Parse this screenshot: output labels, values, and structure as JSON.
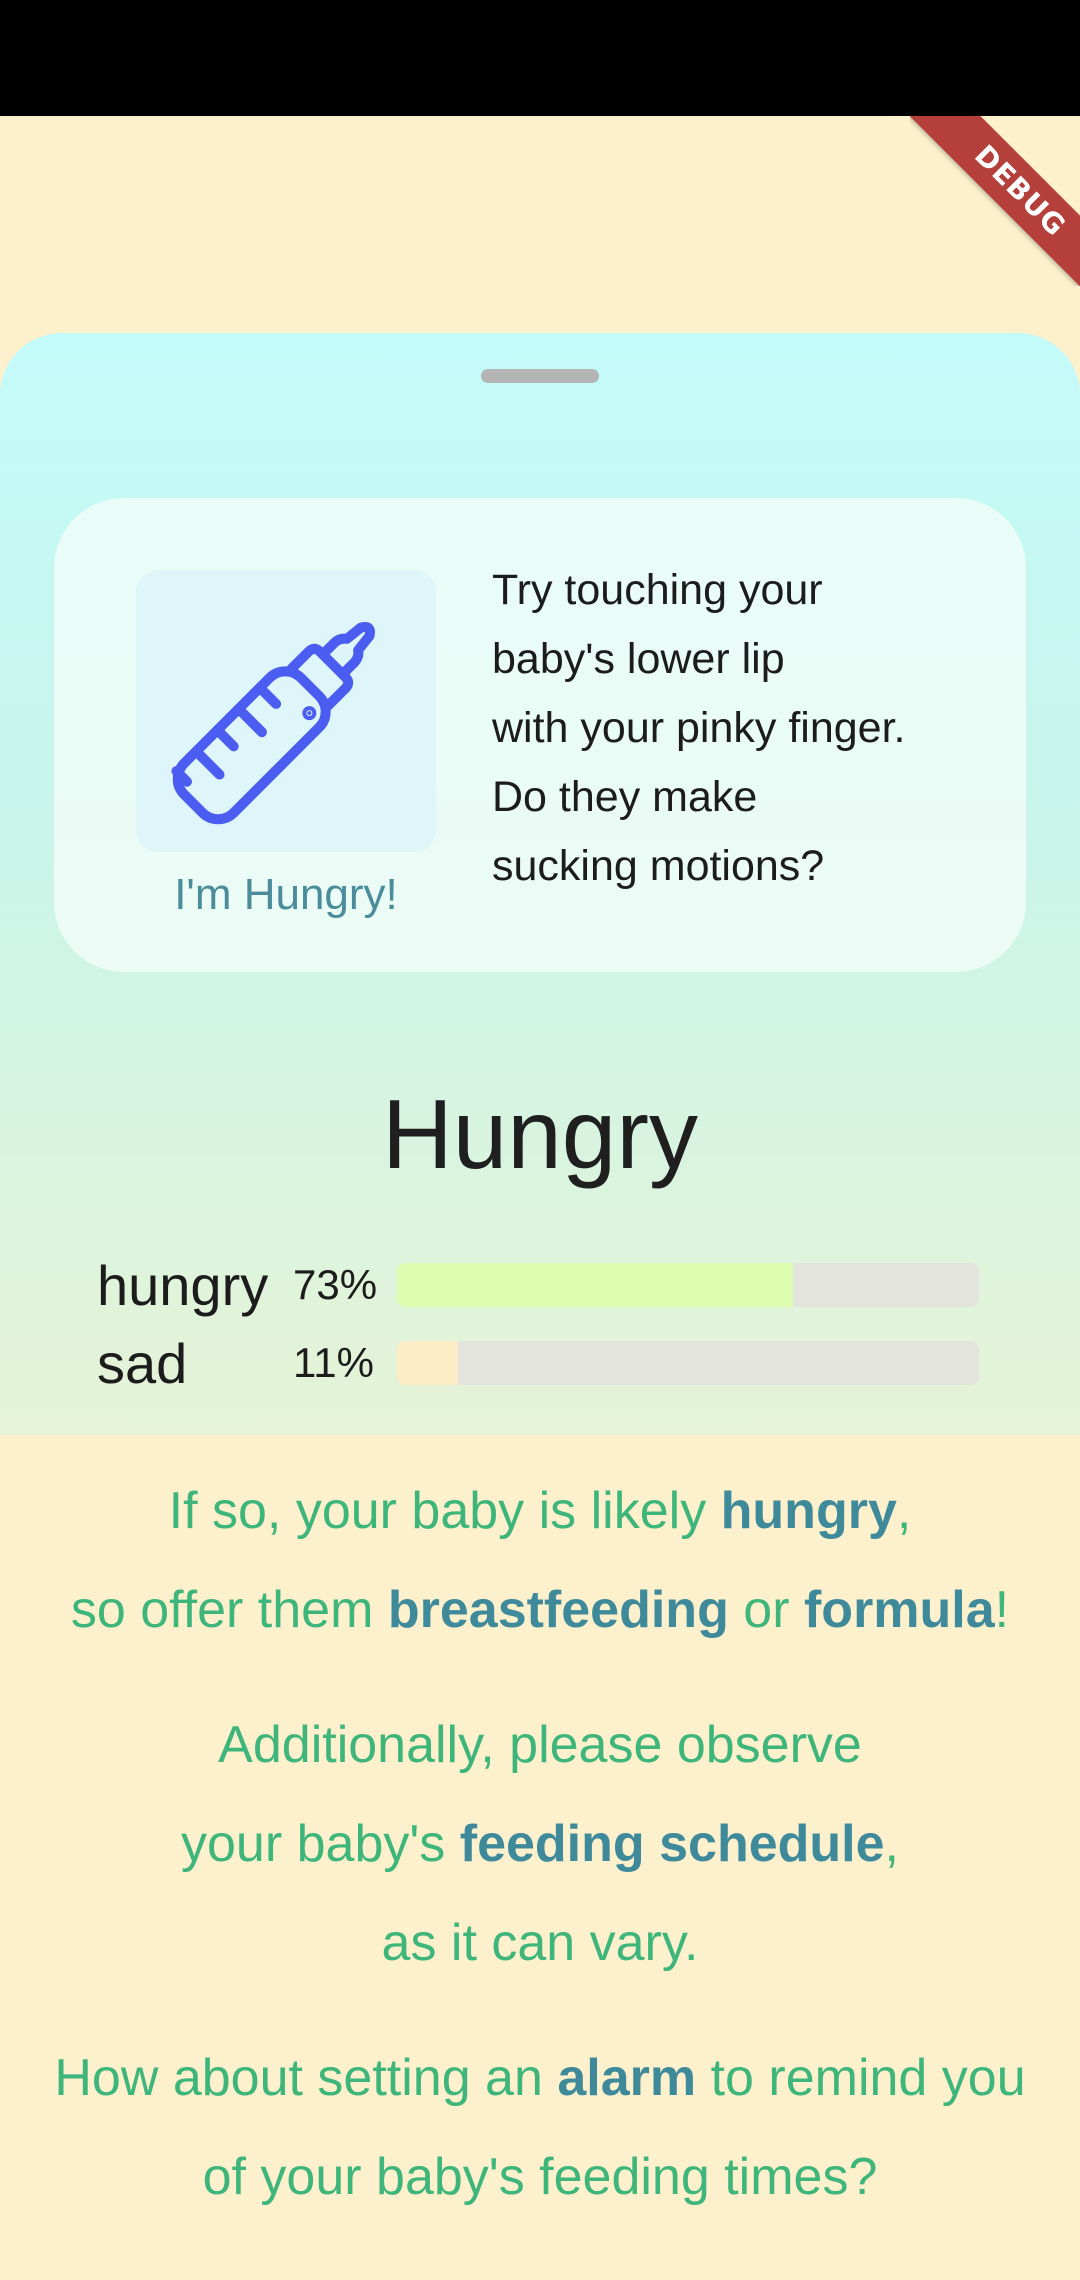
{
  "debug_banner": "DEBUG",
  "tip_card": {
    "icon": "baby-bottle-icon",
    "caption": "I'm Hungry!",
    "lines": [
      "Try touching your",
      "baby's lower lip",
      "with your pinky finger.",
      "Do they make",
      "sucking motions?"
    ]
  },
  "result": {
    "title": "Hungry",
    "emotions": [
      {
        "name": "hungry",
        "percent_label": "73%",
        "value": 0.68,
        "color": "#dcfcb0"
      },
      {
        "name": "sad",
        "percent_label": "11%",
        "value": 0.105,
        "color": "#fdedc6"
      }
    ]
  },
  "advice": {
    "p1": {
      "l1_a": "If so, your baby is likely ",
      "l1_b": "hungry",
      "l1_c": ",",
      "l2_a": "so offer them ",
      "l2_b": "breastfeeding",
      "l2_c": " or ",
      "l2_d": "formula",
      "l2_e": "!"
    },
    "p2": {
      "l1": "Additionally, please observe",
      "l2_a": "your baby's ",
      "l2_b": "feeding schedule",
      "l2_c": ",",
      "l3": "as it can vary."
    },
    "p3": {
      "l1_a": "How about setting an ",
      "l1_b": "alarm",
      "l1_c": " to remind you",
      "l2": "of your baby's feeding times?"
    }
  },
  "colors": {
    "accent_text": "#3eb57a",
    "highlight_text": "#3f8a9a",
    "icon_blue": "#4b5cf0"
  }
}
